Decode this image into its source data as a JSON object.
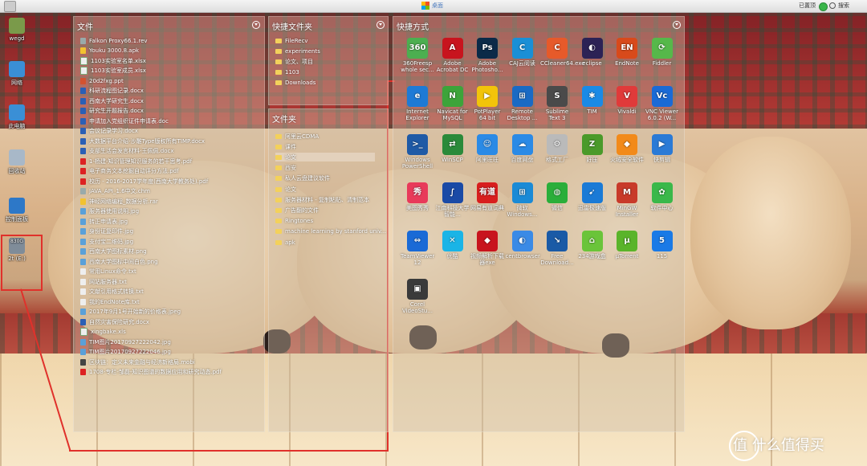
{
  "topbar": {
    "title": "桌面",
    "connection": "已置顶",
    "search": "搜索"
  },
  "desktop_icons": [
    {
      "label": "wegd",
      "color": "#7a9a4a"
    },
    {
      "label": "网络",
      "color": "#3a8fd6"
    },
    {
      "label": "此电脑",
      "color": "#3a8fd6"
    },
    {
      "label": "回收站",
      "color": "#a8b8c8"
    },
    {
      "label": "控制面板",
      "color": "#2d78c8"
    },
    {
      "label": "2t (E:)",
      "sublabel": "830G",
      "color": "#7f8c99"
    }
  ],
  "files_panel": {
    "title": "文件",
    "items": [
      {
        "name": "Falkon Proxy66.1.rev",
        "type": "bin"
      },
      {
        "name": "Youku 3000.8.apk",
        "type": "zip"
      },
      {
        "name": "1103实验室名单.xlsx",
        "type": "xls"
      },
      {
        "name": "1103实验室成员.xlsx",
        "type": "xls"
      },
      {
        "name": "20d2fxg.ppt",
        "type": "ppt"
      },
      {
        "name": "科研流程图记录.docx",
        "type": "doc"
      },
      {
        "name": "西南大学研究生.docx",
        "type": "doc"
      },
      {
        "name": "研究生开题报告.docx",
        "type": "doc"
      },
      {
        "name": "申请加入党组织证件申请表.doc",
        "type": "doc"
      },
      {
        "name": "会议记录学习.docx",
        "type": "doc"
      },
      {
        "name": "大数据平台介绍-沙雕Type版权所有TIMP.docx",
        "type": "doc"
      },
      {
        "name": "支部生活会发言材料-王佩佩.docx",
        "type": "doc"
      },
      {
        "name": "1-杨建-知识管理知识服务的若干思考.pdf",
        "type": "pdf"
      },
      {
        "name": "电子商务文本挖掘自动评分方法.pdf",
        "type": "pdf"
      },
      {
        "name": "校历 - 2016-2017学年度(西南大学教务处).pdf",
        "type": "pdf"
      },
      {
        "name": "JAVA_API_1.6中文.chm",
        "type": "bin"
      },
      {
        "name": "神经网络编程_数据分析.rar",
        "type": "zip"
      },
      {
        "name": "服务器使用说明.jpg",
        "type": "img"
      },
      {
        "name": "转正申请表.jpg",
        "type": "img"
      },
      {
        "name": "身份证复印件.jpg",
        "type": "img"
      },
      {
        "name": "支付宝二维码.jpg",
        "type": "img"
      },
      {
        "name": "西南大学图标素材.png",
        "type": "img"
      },
      {
        "name": "西南大学图标中间白色.png",
        "type": "img"
      },
      {
        "name": "常用Linux命令.txt",
        "type": "txt"
      },
      {
        "name": "网站服务器.txt",
        "type": "txt"
      },
      {
        "name": "文献引用格式转换.txt",
        "type": "txt"
      },
      {
        "name": "我的EndNote库.txt",
        "type": "txt"
      },
      {
        "name": "2017年9月1号开始新的价格表.jpeg",
        "type": "img"
      },
      {
        "name": "自然灾害保险研究.docx",
        "type": "doc"
      },
      {
        "name": "xingbake.xls",
        "type": "xls"
      },
      {
        "name": "TIM图片20170927222042.jpg",
        "type": "img"
      },
      {
        "name": "TIM图片20170927222046.jpg",
        "type": "img"
      },
      {
        "name": "区块链：定义未来金融与经济新格局.mobi",
        "type": "mobi"
      },
      {
        "name": "1708-专栏-邹磊-知识图谱的数据应用和研究动态.pdf",
        "type": "pdf"
      }
    ]
  },
  "quick_folders_panel": {
    "title": "快捷文件夹",
    "items": [
      "FileRecv",
      "experiments",
      "论文、项目",
      "1103",
      "Downloads"
    ]
  },
  "folders_panel": {
    "title": "文件夹",
    "items": [
      "阿里云CDMA",
      "课件",
      "论文",
      "西安",
      "私人云盘建议软件",
      "论文",
      "服务器材料 - 复制粘贴、清制范本",
      "广告翻的文件",
      "Ringtones",
      "machine learning by stanford univ...",
      "apk"
    ],
    "highlight_index": 2
  },
  "shortcuts_panel": {
    "title": "快捷方式",
    "items": [
      {
        "label": "360Freesp whole sec...",
        "icon": "360",
        "color": "#4caf50"
      },
      {
        "label": "Adobe Acrobat DC",
        "icon": "A",
        "color": "#c8141e"
      },
      {
        "label": "Adobe Photosho...",
        "icon": "Ps",
        "color": "#0b2a48"
      },
      {
        "label": "CAJ云阅读",
        "icon": "C",
        "color": "#1a8fd6"
      },
      {
        "label": "CCleaner64.exe",
        "icon": "C",
        "color": "#e65a2a"
      },
      {
        "label": "eclipse",
        "icon": "◐",
        "color": "#2c2255"
      },
      {
        "label": "EndNote",
        "icon": "EN",
        "color": "#d84a1b"
      },
      {
        "label": "Fiddler",
        "icon": "⟳",
        "color": "#56b84a"
      },
      {
        "label": "Internet Explorer",
        "icon": "e",
        "color": "#1e7ad6"
      },
      {
        "label": "Navicat for MySQL",
        "icon": "N",
        "color": "#3ca43a"
      },
      {
        "label": "PotPlayer 64 bit",
        "icon": "▶",
        "color": "#f2c40a"
      },
      {
        "label": "Remote Desktop ...",
        "icon": "⊞",
        "color": "#1a6ac4"
      },
      {
        "label": "Sublime Text 3",
        "icon": "S",
        "color": "#4a4a4a"
      },
      {
        "label": "TIM",
        "icon": "✱",
        "color": "#1a8ae6"
      },
      {
        "label": "Vivaldi",
        "icon": "V",
        "color": "#e03a3a"
      },
      {
        "label": "VNC Viewer 6.0.2 (W...",
        "icon": "Vc",
        "color": "#1a6ad6"
      },
      {
        "label": "Windows PowerShell",
        "icon": ">_",
        "color": "#1f5aa6"
      },
      {
        "label": "WinSCP",
        "icon": "⇄",
        "color": "#2a8a3a"
      },
      {
        "label": "阿里旺旺",
        "icon": "☺",
        "color": "#2a8ae6"
      },
      {
        "label": "百度网盘",
        "icon": "☁",
        "color": "#2a8ae6"
      },
      {
        "label": "格式工厂",
        "icon": "⚙",
        "color": "#bababa"
      },
      {
        "label": "好压",
        "icon": "Z",
        "color": "#4a9a2a"
      },
      {
        "label": "火绒安全软件",
        "icon": "◆",
        "color": "#f28a1a"
      },
      {
        "label": "快剪辑",
        "icon": "▶",
        "color": "#2a7ad6"
      },
      {
        "label": "美图秀秀",
        "icon": "秀",
        "color": "#e83a5a"
      },
      {
        "label": "江南科技大学智能...",
        "icon": "∫",
        "color": "#1a4aa6"
      },
      {
        "label": "网易有道词典",
        "icon": "有道",
        "color": "#d81e1e"
      },
      {
        "label": "微软 Windows...",
        "icon": "⊞",
        "color": "#1a8ad6"
      },
      {
        "label": "微信",
        "icon": "◍",
        "color": "#2aae3a"
      },
      {
        "label": "迅雷极速版",
        "icon": "➹",
        "color": "#1a7ad6"
      },
      {
        "label": "MinGW Installer",
        "icon": "M",
        "color": "#c83a2a"
      },
      {
        "label": "软件中心",
        "icon": "✿",
        "color": "#3ab84a"
      },
      {
        "label": "TeamViewer 12",
        "icon": "⇔",
        "color": "#1a6ad6"
      },
      {
        "label": "优酷",
        "icon": "✕",
        "color": "#1ab4e6"
      },
      {
        "label": "视频解析下载器exe",
        "icon": "◆",
        "color": "#c8141e"
      },
      {
        "label": "centbrowser",
        "icon": "◐",
        "color": "#3a8ae6"
      },
      {
        "label": "Free Download...",
        "icon": "↘",
        "color": "#1a5aa6"
      },
      {
        "label": "234游戏盒",
        "icon": "⌂",
        "color": "#6ac43a"
      },
      {
        "label": "µTorrent",
        "icon": "µ",
        "color": "#5ab42a"
      },
      {
        "label": "115",
        "icon": "5",
        "color": "#1a7ae6"
      },
      {
        "label": "Corel VideoStu...",
        "icon": "▣",
        "color": "#3a3a3a"
      }
    ]
  },
  "watermark": {
    "text": "值 什么值得买"
  }
}
